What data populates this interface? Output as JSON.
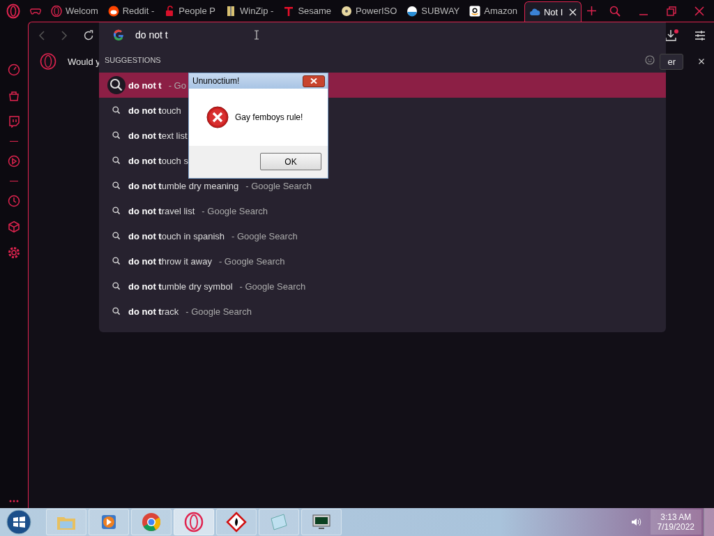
{
  "tabs": [
    {
      "kind": "gamepad",
      "selected": false
    },
    {
      "kind": "opera",
      "label": "Welcom",
      "selected": false
    },
    {
      "kind": "reddit",
      "label": "Reddit -",
      "selected": false
    },
    {
      "kind": "lock",
      "label": "People P",
      "selected": false
    },
    {
      "kind": "zip",
      "label": "WinZip -",
      "selected": false
    },
    {
      "kind": "t",
      "label": "Sesame",
      "selected": false
    },
    {
      "kind": "disc",
      "label": "PowerISO",
      "selected": false
    },
    {
      "kind": "ball",
      "label": "SUBWAY",
      "selected": false
    },
    {
      "kind": "amazon",
      "label": "Amazon",
      "selected": false
    },
    {
      "kind": "cloud",
      "label": "Not I",
      "selected": true
    }
  ],
  "address": {
    "value": "do not t"
  },
  "notification": {
    "text": "Would y",
    "button": "er"
  },
  "suggestions": {
    "heading": "SUGGESTIONS",
    "items": [
      {
        "text": "**do not t**",
        "source": "- Go",
        "selected": true
      },
      {
        "text": "**do not t**ouch",
        "selected": false
      },
      {
        "text": "**do not t**ext list",
        "selected": false
      },
      {
        "text": "**do not t**ouch s",
        "selected": false
      },
      {
        "text": "**do not t**umble dry meaning",
        "source": "- Google Search",
        "selected": false
      },
      {
        "text": "**do not t**ravel list",
        "source": "- Google Search",
        "selected": false
      },
      {
        "text": "**do not t**ouch in spanish",
        "source": "- Google Search",
        "selected": false
      },
      {
        "text": "**do not t**hrow it away",
        "source": "- Google Search",
        "selected": false
      },
      {
        "text": "**do not t**umble dry symbol",
        "source": "- Google Search",
        "selected": false
      },
      {
        "text": "**do not t**rack",
        "source": "- Google Search",
        "selected": false
      }
    ]
  },
  "sidebar": [
    {
      "kind": "speed"
    },
    {
      "kind": "bag"
    },
    {
      "kind": "twitch"
    },
    {
      "kind": "divider"
    },
    {
      "kind": "play"
    },
    {
      "kind": "divider"
    },
    {
      "kind": "clock"
    },
    {
      "kind": "cube"
    },
    {
      "kind": "gear"
    }
  ],
  "dialog": {
    "title": "Ununoctium!",
    "message": "Gay femboys rule!",
    "button": "OK"
  },
  "taskbar": {
    "items": [
      {
        "kind": "folder",
        "selected": false
      },
      {
        "kind": "media",
        "selected": false
      },
      {
        "kind": "chrome",
        "selected": false
      },
      {
        "kind": "opera",
        "selected": true
      },
      {
        "kind": "hazard",
        "selected": false
      },
      {
        "kind": "notepad",
        "selected": false
      },
      {
        "kind": "monitor",
        "selected": false
      }
    ],
    "time": "3:13 AM",
    "date": "7/19/2022"
  }
}
